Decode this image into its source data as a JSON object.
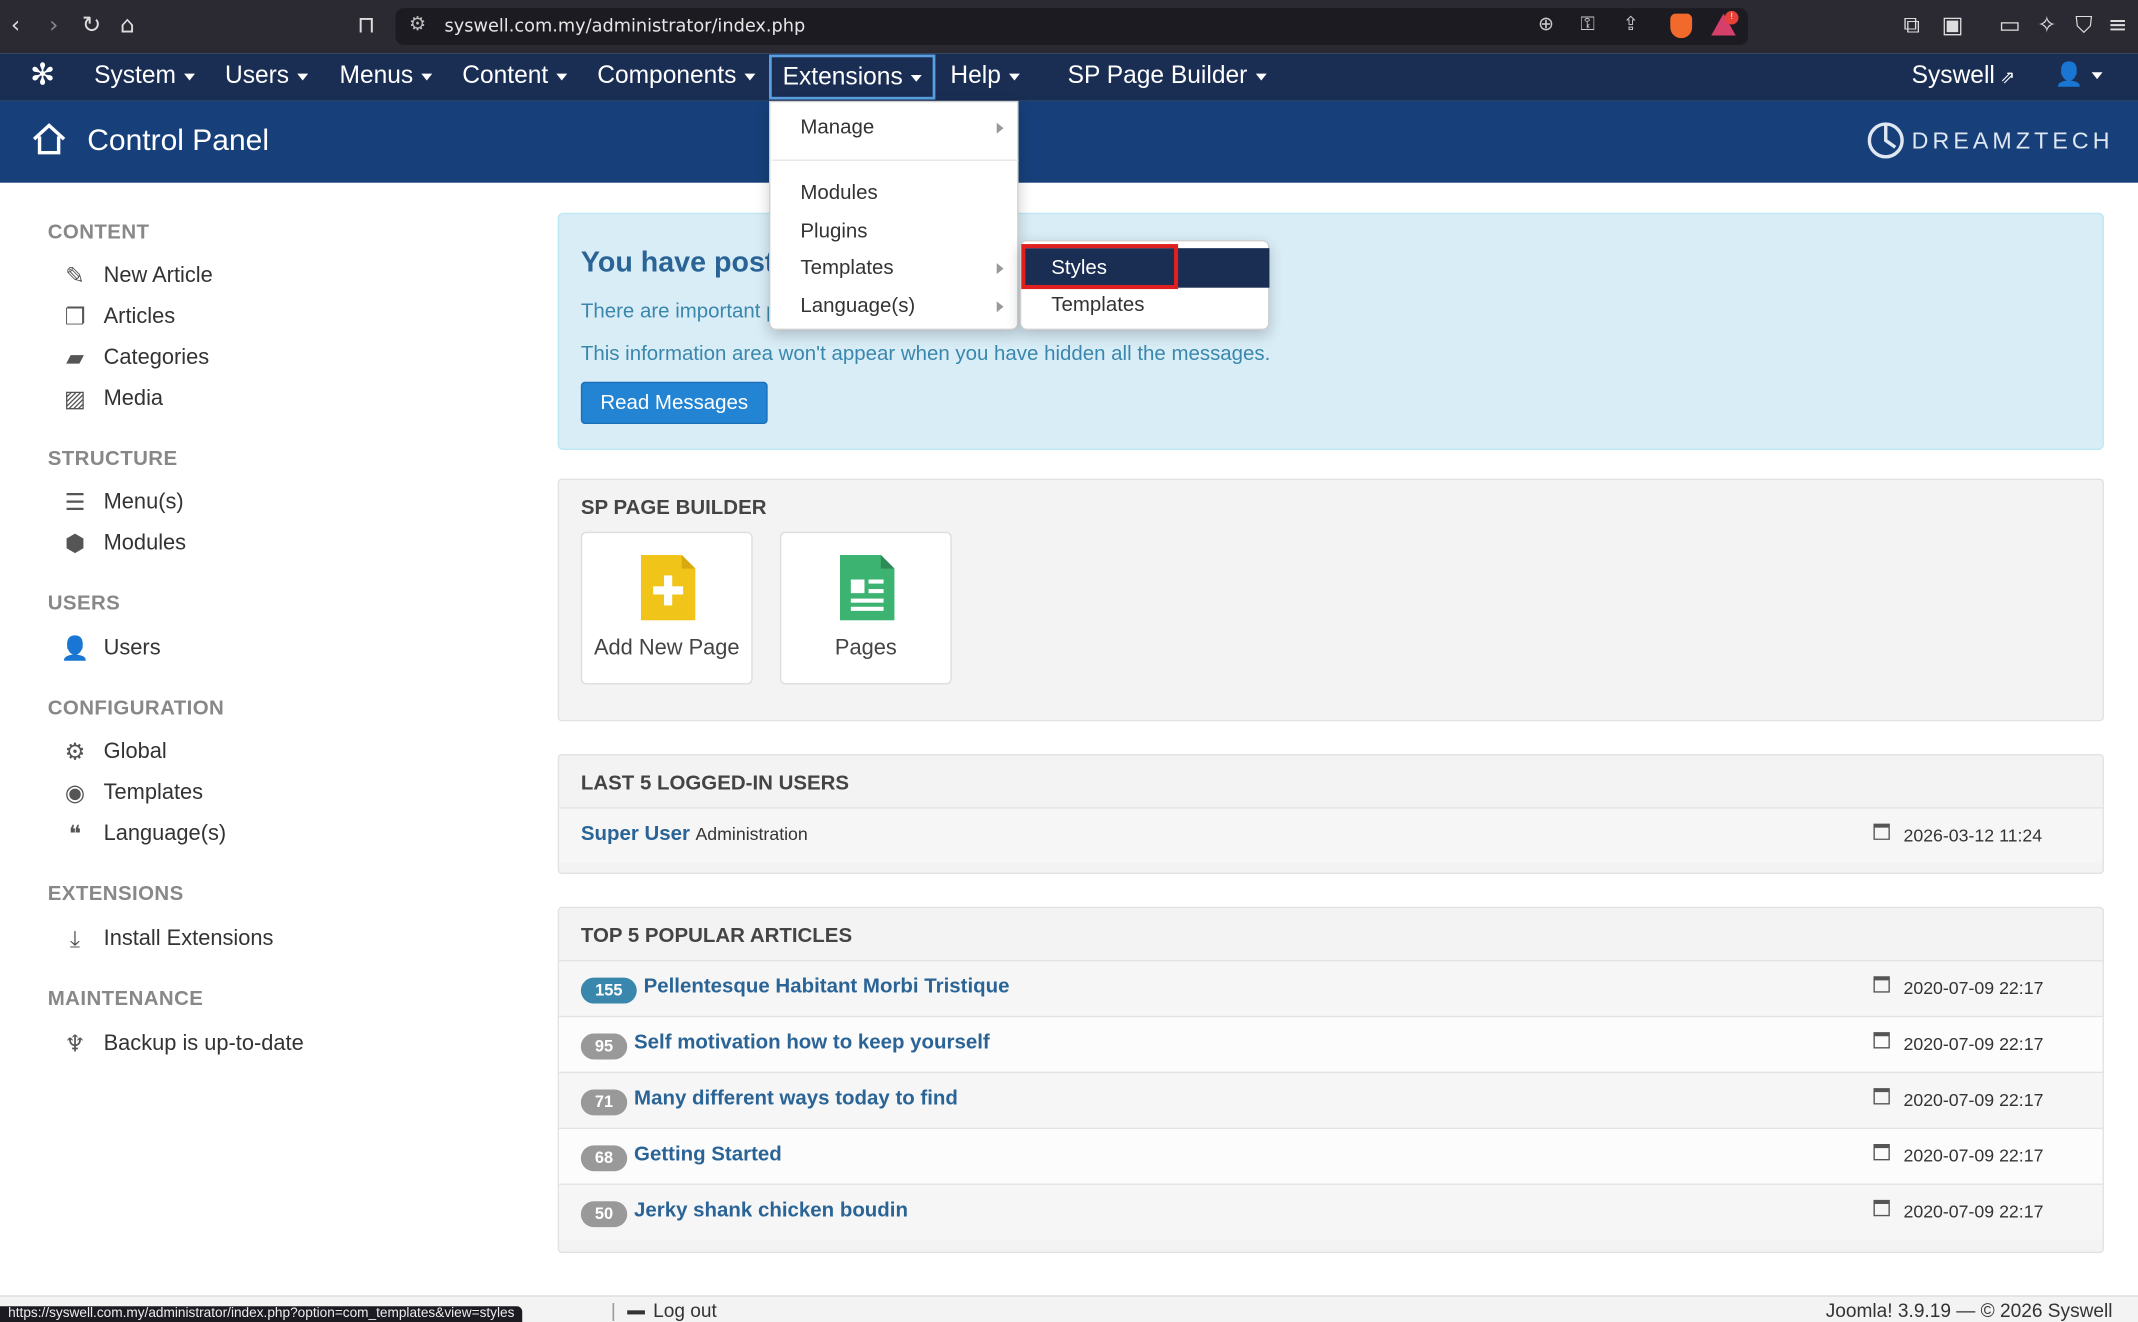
{
  "browser": {
    "url": "syswell.com.my/administrator/index.php",
    "status_url": "https://syswell.com.my/administrator/index.php?option=com_templates&view=styles"
  },
  "topnav": {
    "items": [
      {
        "label": "System"
      },
      {
        "label": "Users"
      },
      {
        "label": "Menus"
      },
      {
        "label": "Content"
      },
      {
        "label": "Components"
      },
      {
        "label": "Extensions"
      },
      {
        "label": "Help"
      },
      {
        "label": "SP Page Builder"
      }
    ],
    "site_link": "Syswell"
  },
  "header": {
    "title": "Control Panel",
    "brand": "DREAMZTECH"
  },
  "sidebar": {
    "sections": [
      {
        "heading": "CONTENT",
        "items": [
          "New Article",
          "Articles",
          "Categories",
          "Media"
        ]
      },
      {
        "heading": "STRUCTURE",
        "items": [
          "Menu(s)",
          "Modules"
        ]
      },
      {
        "heading": "USERS",
        "items": [
          "Users"
        ]
      },
      {
        "heading": "CONFIGURATION",
        "items": [
          "Global",
          "Templates",
          "Language(s)"
        ]
      },
      {
        "heading": "EXTENSIONS",
        "items": [
          "Install Extensions"
        ]
      },
      {
        "heading": "MAINTENANCE",
        "items": [
          "Backup is up-to-date"
        ]
      }
    ]
  },
  "messages": {
    "title": "You have post",
    "line1": "There are important p",
    "line2": "This information area won't appear when you have hidden all the messages.",
    "button": "Read Messages"
  },
  "sppb": {
    "title": "SP PAGE BUILDER",
    "tiles": [
      "Add New Page",
      "Pages"
    ]
  },
  "logged_users": {
    "title": "LAST 5 LOGGED-IN USERS",
    "rows": [
      {
        "name": "Super User",
        "role": "Administration",
        "date": "2026-03-12 11:24"
      }
    ]
  },
  "popular": {
    "title": "TOP 5 POPULAR ARTICLES",
    "rows": [
      {
        "hits": "155",
        "title": "Pellentesque Habitant Morbi Tristique",
        "date": "2020-07-09 22:17"
      },
      {
        "hits": "95",
        "title": "Self motivation how to keep yourself",
        "date": "2020-07-09 22:17"
      },
      {
        "hits": "71",
        "title": "Many different ways today to find",
        "date": "2020-07-09 22:17"
      },
      {
        "hits": "68",
        "title": "Getting Started",
        "date": "2020-07-09 22:17"
      },
      {
        "hits": "50",
        "title": "Jerky shank chicken boudin",
        "date": "2020-07-09 22:17"
      }
    ]
  },
  "extensions_menu": {
    "items": [
      "Manage",
      "Modules",
      "Plugins",
      "Templates",
      "Language(s)"
    ],
    "templates_submenu": [
      "Styles",
      "Templates"
    ]
  },
  "footer": {
    "logout": "Log out",
    "version": "Joomla! 3.9.19 — © 2026 Syswell"
  },
  "colors": {
    "nav": "#1a2d53",
    "header": "#17407a",
    "link": "#2a6496",
    "primary_button": "#2384d3",
    "highlight": "#e02020"
  }
}
